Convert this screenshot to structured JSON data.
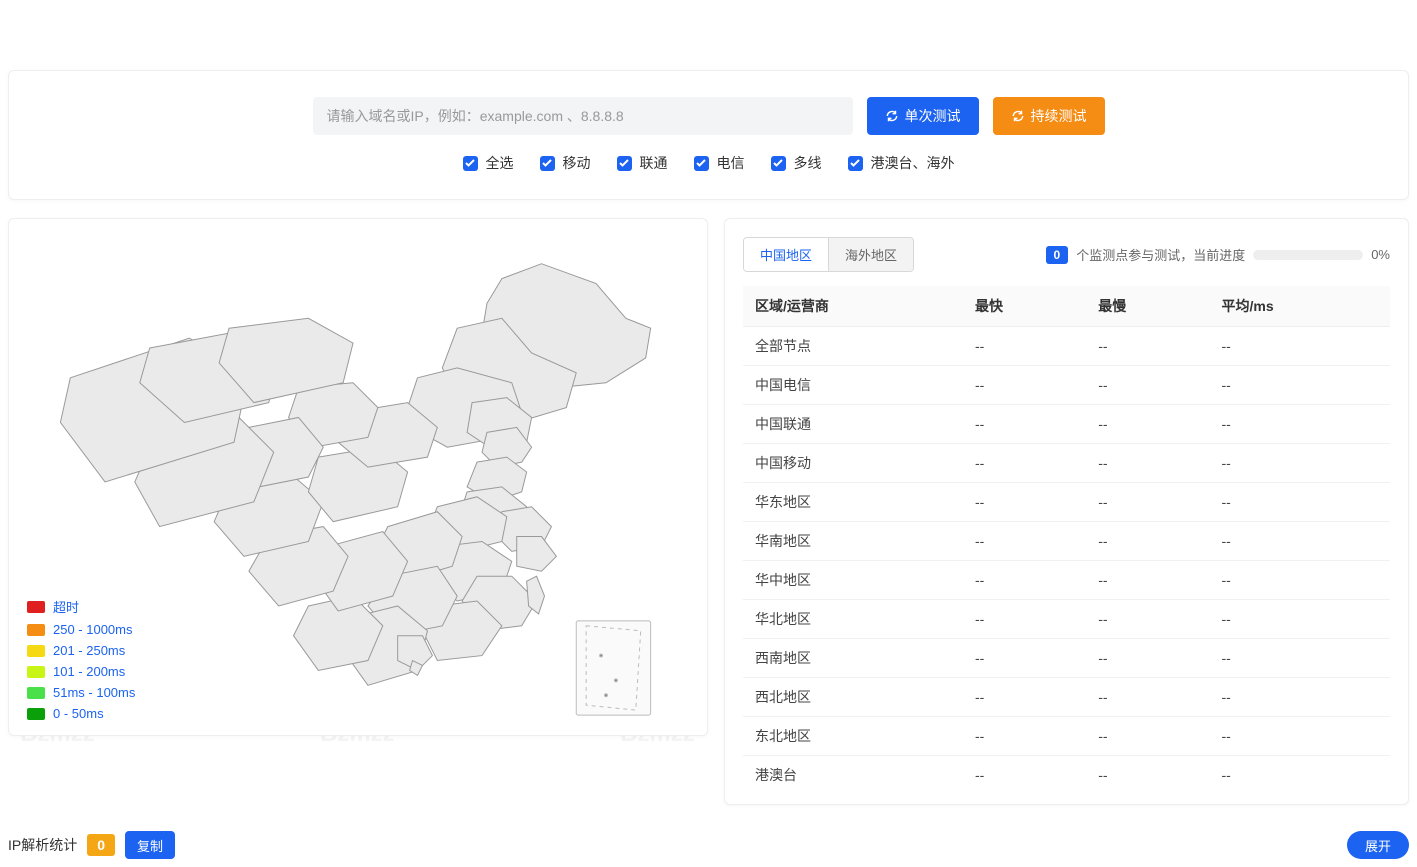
{
  "watermark_text": "Bzmzz",
  "search": {
    "placeholder": "请输入域名或IP，例如：example.com 、8.8.8.8",
    "single_test_label": "单次测试",
    "continuous_test_label": "持续测试"
  },
  "filters": {
    "all": "全选",
    "mobile": "移动",
    "unicom": "联通",
    "telecom": "电信",
    "multiline": "多线",
    "overseas": "港澳台、海外"
  },
  "legend": [
    {
      "color": "#e02020",
      "label": "超时"
    },
    {
      "color": "#f58c14",
      "label": "250 - 1000ms"
    },
    {
      "color": "#f5d914",
      "label": "201 - 250ms"
    },
    {
      "color": "#c8f514",
      "label": "101 - 200ms"
    },
    {
      "color": "#4ae04a",
      "label": "51ms - 100ms"
    },
    {
      "color": "#0aa00a",
      "label": "0 - 50ms"
    }
  ],
  "tabs": {
    "china": "中国地区",
    "overseas": "海外地区"
  },
  "progress": {
    "count": "0",
    "label_a": "个监测点参与测试，当前进度",
    "percent": "0%"
  },
  "table": {
    "headers": {
      "region": "区域/运营商",
      "fastest": "最快",
      "slowest": "最慢",
      "avg": "平均/ms"
    },
    "rows": [
      {
        "region": "全部节点",
        "fastest": "--",
        "slowest": "--",
        "avg": "--"
      },
      {
        "region": "中国电信",
        "fastest": "--",
        "slowest": "--",
        "avg": "--"
      },
      {
        "region": "中国联通",
        "fastest": "--",
        "slowest": "--",
        "avg": "--"
      },
      {
        "region": "中国移动",
        "fastest": "--",
        "slowest": "--",
        "avg": "--"
      },
      {
        "region": "华东地区",
        "fastest": "--",
        "slowest": "--",
        "avg": "--"
      },
      {
        "region": "华南地区",
        "fastest": "--",
        "slowest": "--",
        "avg": "--"
      },
      {
        "region": "华中地区",
        "fastest": "--",
        "slowest": "--",
        "avg": "--"
      },
      {
        "region": "华北地区",
        "fastest": "--",
        "slowest": "--",
        "avg": "--"
      },
      {
        "region": "西南地区",
        "fastest": "--",
        "slowest": "--",
        "avg": "--"
      },
      {
        "region": "西北地区",
        "fastest": "--",
        "slowest": "--",
        "avg": "--"
      },
      {
        "region": "东北地区",
        "fastest": "--",
        "slowest": "--",
        "avg": "--"
      },
      {
        "region": "港澳台",
        "fastest": "--",
        "slowest": "--",
        "avg": "--"
      }
    ]
  },
  "footer": {
    "ip_label": "IP解析统计",
    "ip_count": "0",
    "copy_label": "复制",
    "expand_label": "展开"
  }
}
